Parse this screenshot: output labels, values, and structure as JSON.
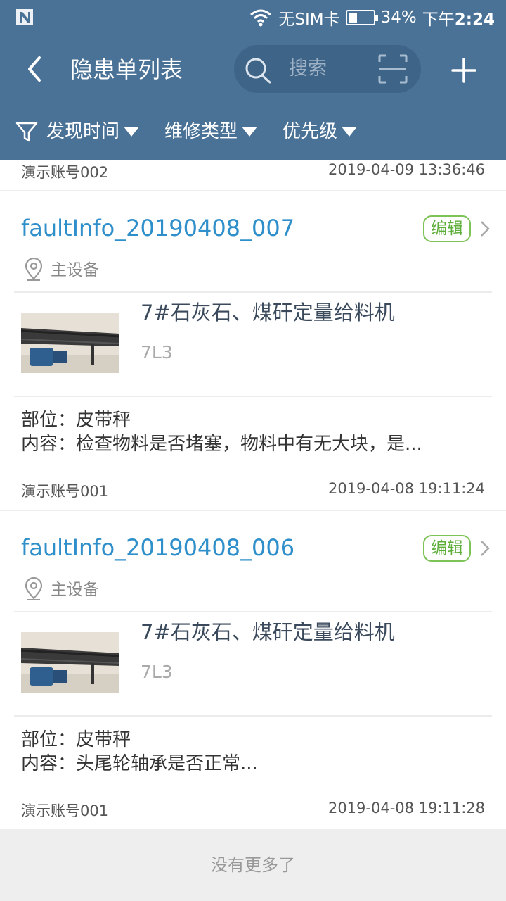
{
  "status_bar": {
    "carrier": "无SIM卡",
    "battery": "34%",
    "battery_level": 0.34,
    "time_prefix": "下午",
    "time": "2:24"
  },
  "nav": {
    "title": "隐患单列表",
    "search_placeholder": "搜索"
  },
  "filters": {
    "items": [
      {
        "label": "发现时间"
      },
      {
        "label": "维修类型"
      },
      {
        "label": "优先级"
      }
    ]
  },
  "previous_item": {
    "account": "演示账号002",
    "datetime": "2019-04-09 13:36:46"
  },
  "cards": [
    {
      "title": "faultInfo_20190408_007",
      "edit_label": "编辑",
      "location": "主设备",
      "equipment_name": "7#石灰石、煤矸定量给料机",
      "equipment_code": "7L3",
      "part_line": "部位：皮带秤",
      "content_line": "内容：检查物料是否堵塞，物料中有无大块，是...",
      "account": "演示账号001",
      "datetime": "2019-04-08 19:11:24"
    },
    {
      "title": "faultInfo_20190408_006",
      "edit_label": "编辑",
      "location": "主设备",
      "equipment_name": "7#石灰石、煤矸定量给料机",
      "equipment_code": "7L3",
      "part_line": "部位：皮带秤",
      "content_line": "内容：头尾轮轴承是否正常...",
      "account": "演示账号001",
      "datetime": "2019-04-08 19:11:28"
    }
  ],
  "footer": {
    "no_more": "没有更多了"
  },
  "colors": {
    "header_bg": "#4a7196",
    "title_link": "#2f8fca",
    "edit_green": "#5eae3a"
  }
}
